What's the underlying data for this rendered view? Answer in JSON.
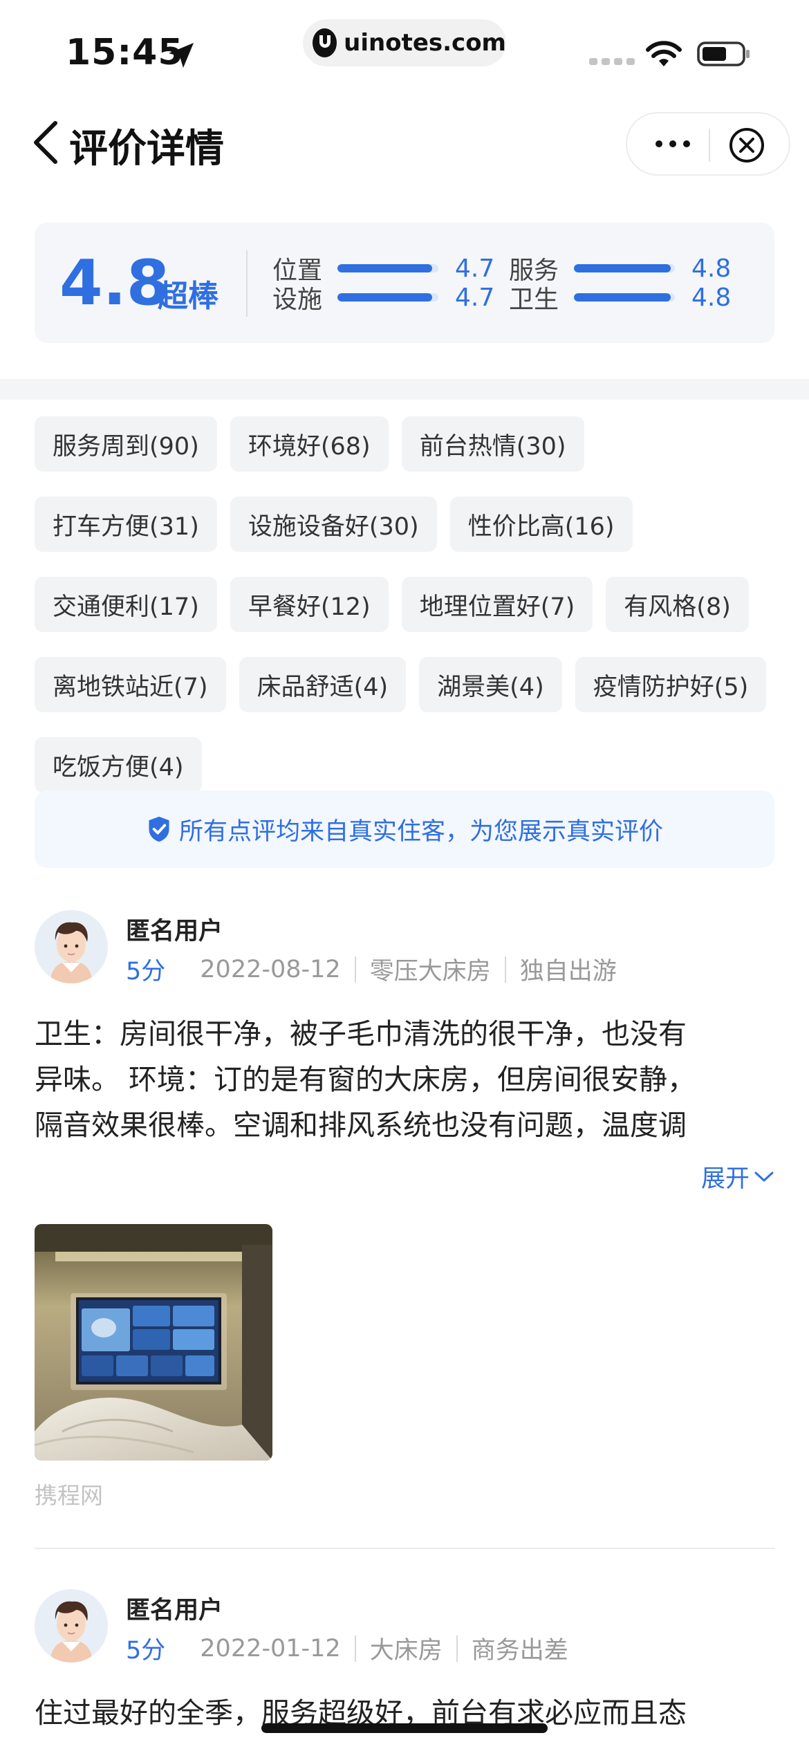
{
  "status_bar": {
    "time": "15:45",
    "url": "uinotes.com",
    "icons": [
      "location-arrow-icon",
      "signal-icon",
      "wifi-icon",
      "battery-icon"
    ]
  },
  "nav": {
    "title": "评价详情",
    "back_icon": "chevron-left-icon",
    "more_icon": "more-icon",
    "close_icon": "close-circle-icon"
  },
  "rating": {
    "score": "4.8",
    "label": "超棒",
    "subscores": [
      {
        "name": "位置",
        "value": "4.7",
        "level": 0.94
      },
      {
        "name": "服务",
        "value": "4.8",
        "level": 0.96
      },
      {
        "name": "设施",
        "value": "4.7",
        "level": 0.94
      },
      {
        "name": "卫生",
        "value": "4.8",
        "level": 0.96
      }
    ]
  },
  "tags": [
    "服务周到(90)",
    "环境好(68)",
    "前台热情(30)",
    "打车方便(31)",
    "设施设备好(30)",
    "性价比高(16)",
    "交通便利(17)",
    "早餐好(12)",
    "地理位置好(7)",
    "有风格(8)",
    "离地铁站近(7)",
    "床品舒适(4)",
    "湖景美(4)",
    "疫情防护好(5)",
    "吃饭方便(4)"
  ],
  "notice": {
    "icon": "shield-check-icon",
    "text": "所有点评均来自真实住客，为您展示真实评价"
  },
  "reviews": [
    {
      "user": "匿名用户",
      "score": "5分",
      "date": "2022-08-12",
      "room": "零压大床房",
      "trip": "独自出游",
      "lines": [
        "卫生：房间很干净，被子毛巾清洗的很干净，也没有",
        "异味。 环境：订的是有窗的大床房，但房间很安静，",
        "隔音效果很棒。空调和排风系统也没有问题，温度调"
      ],
      "expand": "展开",
      "source": "携程网"
    },
    {
      "user": "匿名用户",
      "score": "5分",
      "date": "2022-01-12",
      "room": "大床房",
      "trip": "商务出差",
      "lines": [
        "住过最好的全季，服务超级好，前台有求必应而且态"
      ]
    }
  ],
  "colors": {
    "accent": "#2f6fe0",
    "tag_bg": "#f2f3f5",
    "card_bg": "#f4f6f9"
  }
}
